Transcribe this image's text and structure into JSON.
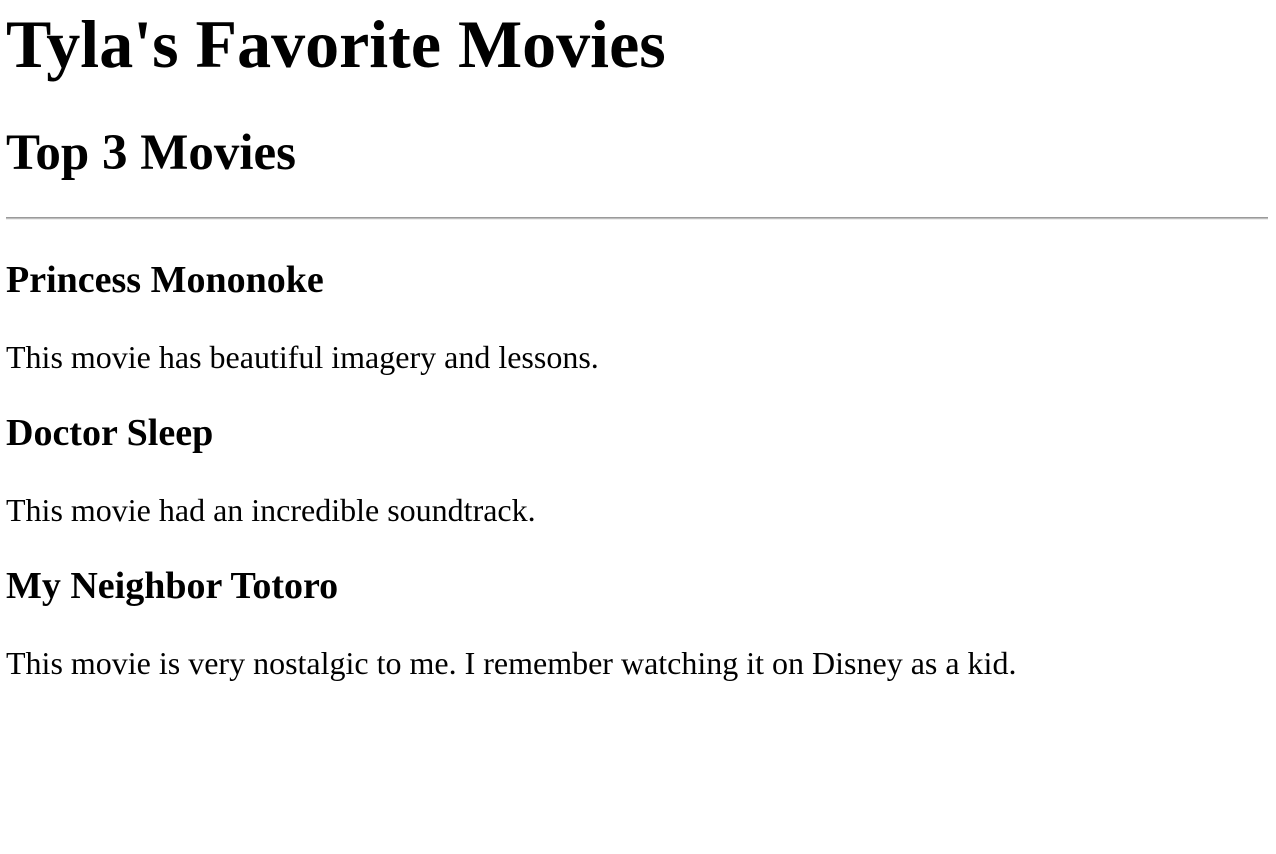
{
  "page": {
    "title": "Tyla's Favorite Movies",
    "subtitle": "Top 3 Movies"
  },
  "movies": [
    {
      "title": "Princess Mononoke",
      "description": "This movie has beautiful imagery and lessons."
    },
    {
      "title": "Doctor Sleep",
      "description": "This movie had an incredible soundtrack."
    },
    {
      "title": "My Neighbor Totoro",
      "description": "This movie is very nostalgic to me. I remember watching it on Disney as a kid."
    }
  ]
}
